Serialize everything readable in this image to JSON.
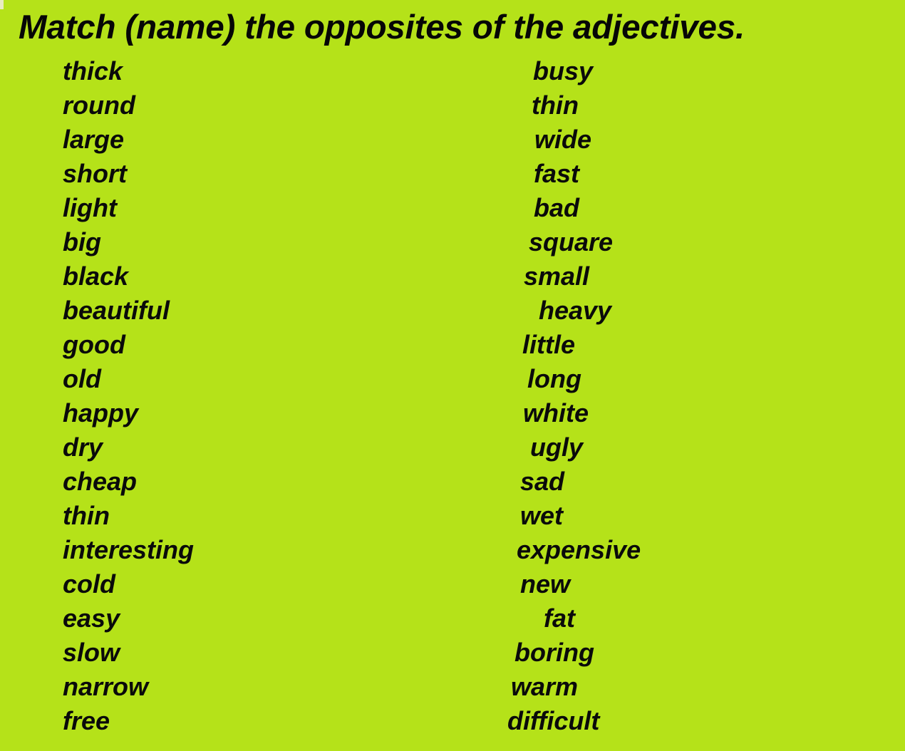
{
  "worksheet": {
    "title": "Match (name) the opposites of the adjectives.",
    "background_color": "#b5e219",
    "text_color": "#0a0a0a",
    "left_column": [
      {
        "word": "thick",
        "indent": 0
      },
      {
        "word": "round",
        "indent": 0
      },
      {
        "word": "large",
        "indent": 0
      },
      {
        "word": "short",
        "indent": 0
      },
      {
        "word": "light",
        "indent": 0
      },
      {
        "word": "big",
        "indent": 0
      },
      {
        "word": "black",
        "indent": 0
      },
      {
        "word": "beautiful",
        "indent": 0
      },
      {
        "word": "good",
        "indent": 0
      },
      {
        "word": "old",
        "indent": 0
      },
      {
        "word": "happy",
        "indent": 0
      },
      {
        "word": "dry",
        "indent": 0
      },
      {
        "word": "cheap",
        "indent": 0
      },
      {
        "word": "thin",
        "indent": 0
      },
      {
        "word": "interesting",
        "indent": 0
      },
      {
        "word": "cold",
        "indent": 0
      },
      {
        "word": "easy",
        "indent": 0
      },
      {
        "word": "slow",
        "indent": 0
      },
      {
        "word": "narrow",
        "indent": 0
      },
      {
        "word": "free",
        "indent": 0
      }
    ],
    "right_column": [
      {
        "word": "busy",
        "indent": 88
      },
      {
        "word": "thin",
        "indent": 86
      },
      {
        "word": "wide",
        "indent": 90
      },
      {
        "word": "fast",
        "indent": 89
      },
      {
        "word": "bad",
        "indent": 89
      },
      {
        "word": "square",
        "indent": 82
      },
      {
        "word": "small",
        "indent": 75
      },
      {
        "word": "heavy",
        "indent": 96
      },
      {
        "word": "little",
        "indent": 73
      },
      {
        "word": "long",
        "indent": 80
      },
      {
        "word": "white",
        "indent": 74
      },
      {
        "word": "ugly",
        "indent": 84
      },
      {
        "word": "sad",
        "indent": 70
      },
      {
        "word": "wet",
        "indent": 70
      },
      {
        "word": "expensive",
        "indent": 65
      },
      {
        "word": "new",
        "indent": 70
      },
      {
        "word": "fat",
        "indent": 103
      },
      {
        "word": "boring",
        "indent": 62
      },
      {
        "word": "warm",
        "indent": 57
      },
      {
        "word": "difficult",
        "indent": 52
      }
    ]
  }
}
